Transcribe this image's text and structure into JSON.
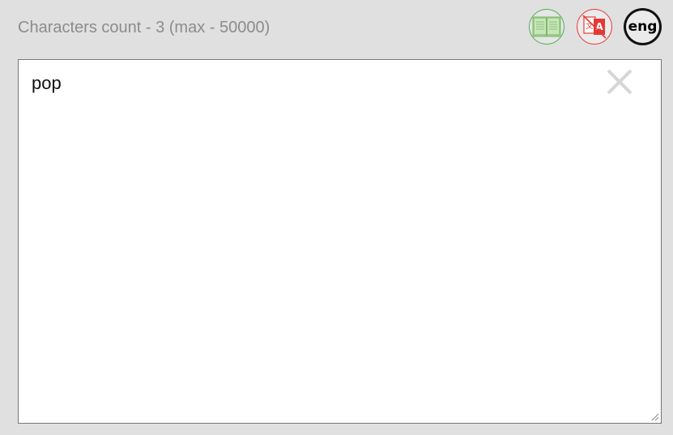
{
  "header": {
    "char_count_text": "Characters count - 3 (max - 50000)"
  },
  "toolbar": {
    "dictionary_icon": "open-book-icon",
    "translate_icon": "translate-disabled-icon",
    "language_label": "eng"
  },
  "editor": {
    "value": "pop",
    "clear_icon": "close-icon"
  },
  "colors": {
    "background": "#e0e0e0",
    "dictionary_accent": "#4caf50",
    "translate_accent": "#e53935",
    "count_text": "#8c8c8c"
  }
}
